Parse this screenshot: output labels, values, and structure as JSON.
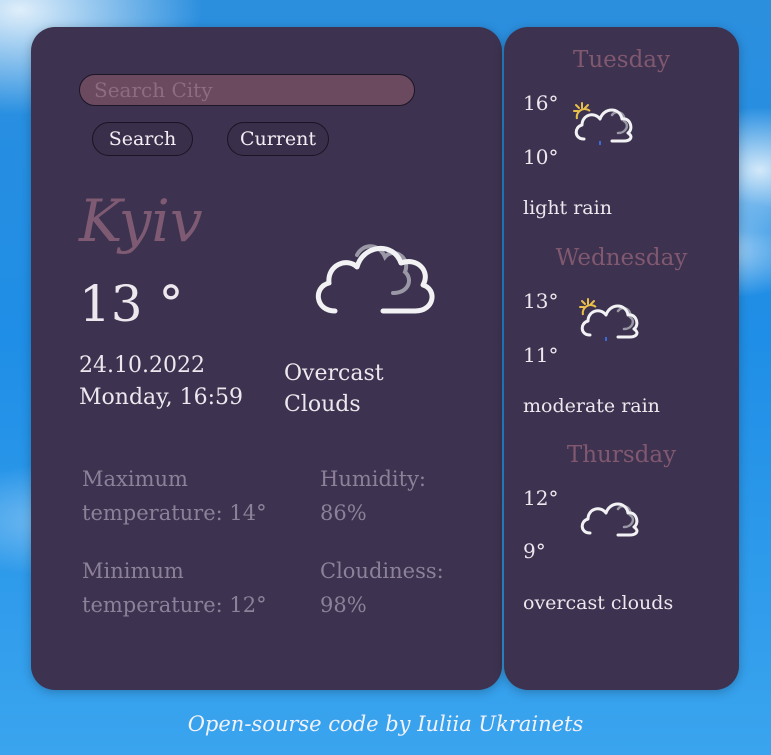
{
  "search": {
    "placeholder": "Search City",
    "search_label": "Search",
    "current_label": "Current"
  },
  "current": {
    "city": "Kyiv",
    "temperature": "13 °",
    "date": "24.10.2022",
    "day_time": "Monday, 16:59",
    "description_line1": "Overcast",
    "description_line2": "Clouds",
    "icon": "overcast-clouds-icon"
  },
  "stats": {
    "max_label": "Maximum",
    "max_value": "temperature: 14°",
    "humidity_label": "Humidity:",
    "humidity_value": "86%",
    "min_label": "Minimum",
    "min_value": "temperature: 12°",
    "cloud_label": "Cloudiness:",
    "cloud_value": "98%"
  },
  "forecast": [
    {
      "day": "Tuesday",
      "high": "16°",
      "low": "10°",
      "description": "light rain",
      "icon": "sun-rain-cloud-icon"
    },
    {
      "day": "Wednesday",
      "high": "13°",
      "low": "11°",
      "description": "moderate rain",
      "icon": "sun-rain-cloud-icon"
    },
    {
      "day": "Thursday",
      "high": "12°",
      "low": "9°",
      "description": "overcast clouds",
      "icon": "overcast-clouds-icon"
    }
  ],
  "footer": {
    "credit": "Open-sourse code by Iuliia Ukrainets"
  },
  "colors": {
    "card_background": "#3d324f",
    "city_accent": "#7e5a73",
    "forecast_day_accent": "#80586f",
    "search_field": "#6b4a60",
    "stat_text": "#8c8199"
  }
}
